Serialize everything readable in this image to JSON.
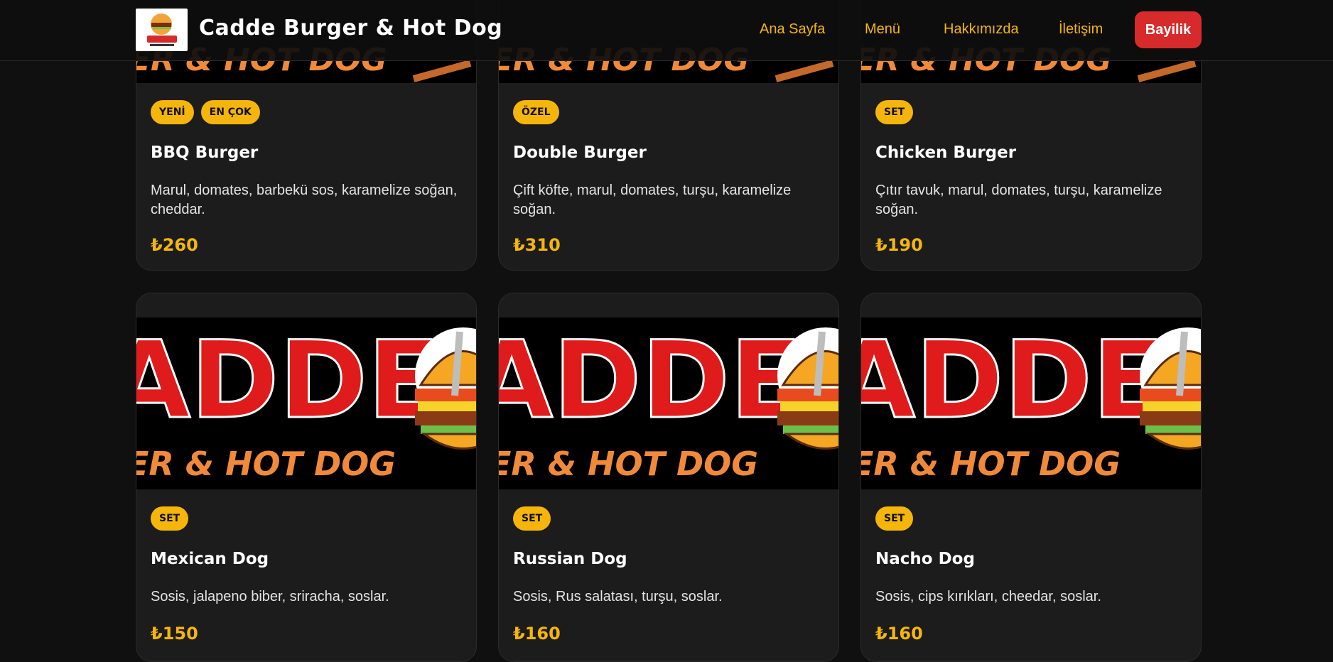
{
  "header": {
    "brand": "Cadde Burger & Hot Dog",
    "nav": [
      "Ana Sayfa",
      "Menü",
      "Hakkımızda",
      "İletişim"
    ],
    "cta": "Bayilik"
  },
  "banner": {
    "word": "ADDE",
    "sub": "ER & HOT DOG"
  },
  "cards": [
    {
      "badges": [
        "YENİ",
        "EN ÇOK"
      ],
      "title": "BBQ Burger",
      "desc": "Marul, domates, barbekü sos, karamelize soğan, cheddar.",
      "price": "₺260"
    },
    {
      "badges": [
        "ÖZEL"
      ],
      "title": "Double Burger",
      "desc": "Çift köfte, marul, domates, turşu, karamelize soğan.",
      "price": "₺310"
    },
    {
      "badges": [
        "SET"
      ],
      "title": "Chicken Burger",
      "desc": "Çıtır tavuk, marul, domates, turşu, karamelize soğan.",
      "price": "₺190"
    },
    {
      "badges": [
        "SET"
      ],
      "title": "Mexican Dog",
      "desc": "Sosis, jalapeno biber, sriracha, soslar.",
      "price": "₺150"
    },
    {
      "badges": [
        "SET"
      ],
      "title": "Russian Dog",
      "desc": "Sosis, Rus salatası, turşu, soslar.",
      "price": "₺160"
    },
    {
      "badges": [
        "SET"
      ],
      "title": "Nacho Dog",
      "desc": "Sosis, cips kırıkları, cheedar, soslar.",
      "price": "₺160"
    }
  ],
  "colors": {
    "accent": "#f5b50b",
    "cta": "#d72a2a",
    "card": "#1c1c1c",
    "background": "#101010"
  }
}
